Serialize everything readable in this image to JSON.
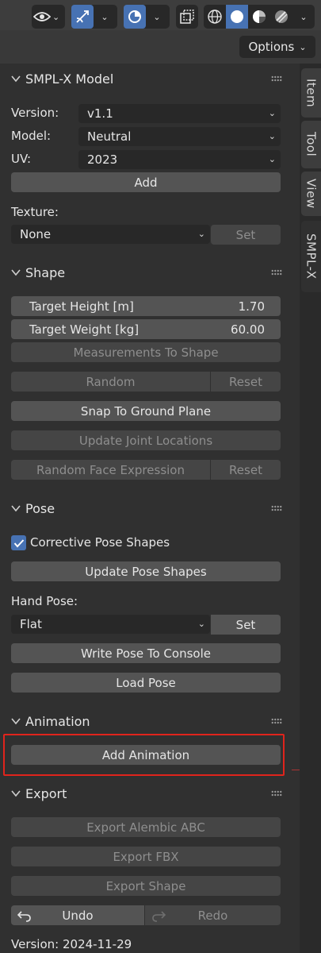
{
  "header": {
    "options_label": "Options"
  },
  "tabs": [
    "Item",
    "Tool",
    "View",
    "SMPL-X"
  ],
  "smplx_model": {
    "title": "SMPL-X Model",
    "version_label": "Version:",
    "version_value": "v1.1",
    "model_label": "Model:",
    "model_value": "Neutral",
    "uv_label": "UV:",
    "uv_value": "2023",
    "add_label": "Add",
    "texture_label": "Texture:",
    "texture_value": "None",
    "set_label": "Set"
  },
  "shape": {
    "title": "Shape",
    "target_height_label": "Target Height [m]",
    "target_height_value": "1.70",
    "target_weight_label": "Target Weight [kg]",
    "target_weight_value": "60.00",
    "measurements_label": "Measurements To Shape",
    "random_label": "Random",
    "reset_label": "Reset",
    "snap_label": "Snap To Ground Plane",
    "update_joint_label": "Update Joint Locations",
    "random_face_label": "Random Face Expression",
    "reset_face_label": "Reset"
  },
  "pose": {
    "title": "Pose",
    "corrective_label": "Corrective Pose Shapes",
    "corrective_checked": true,
    "update_pose_label": "Update Pose Shapes",
    "hand_pose_label": "Hand Pose:",
    "hand_pose_value": "Flat",
    "set_label": "Set",
    "write_pose_label": "Write Pose To Console",
    "load_pose_label": "Load Pose"
  },
  "animation": {
    "title": "Animation",
    "add_animation_label": "Add Animation"
  },
  "export": {
    "title": "Export",
    "alembic_label": "Export Alembic ABC",
    "fbx_label": "Export FBX",
    "shape_label": "Export Shape",
    "undo_label": "Undo",
    "redo_label": "Redo",
    "version_text": "Version: 2024-11-29"
  },
  "colors": {
    "accent": "#4772b3",
    "highlight": "#e0241c"
  }
}
